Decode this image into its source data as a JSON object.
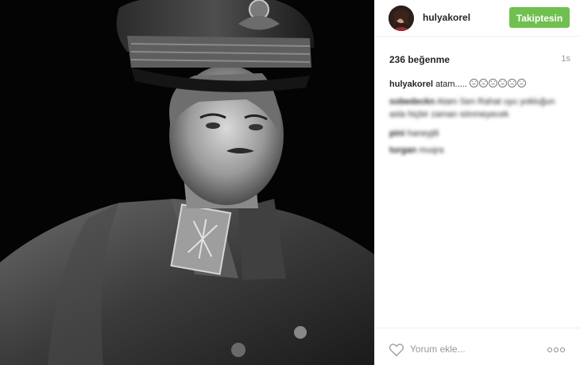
{
  "header": {
    "username": "hulyakorel",
    "follow_label": "Takiptesin",
    "follow_color": "#70c050"
  },
  "stats": {
    "likes": "236 beğenme",
    "time": "1s"
  },
  "caption": {
    "username": "hulyakorel",
    "text": "atam.....",
    "emoji_count": 6
  },
  "comments": [
    {
      "username": "sobedeckn",
      "text": "Atam Sen Rahat uyu yokluğun asla hiçbir zaman sönmeyecek",
      "blurred": true
    },
    {
      "username": "pini",
      "text": "haneyjili",
      "blurred": true
    },
    {
      "username": "turgan",
      "text": "muqra",
      "blurred": true
    }
  ],
  "footer": {
    "comment_placeholder": "Yorum ekle...",
    "like_icon": "heart-outline-icon",
    "more_icon": "more-options-icon"
  }
}
